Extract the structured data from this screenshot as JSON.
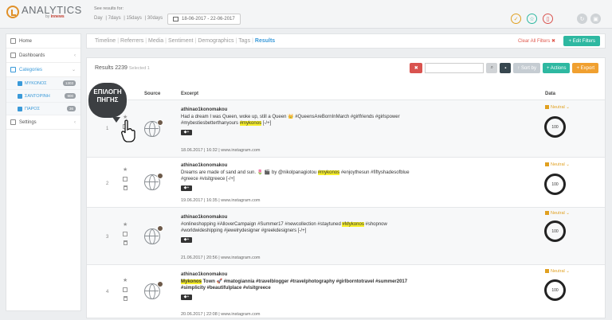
{
  "app": {
    "logo_text": "ANALYTICS",
    "logo_sub_prefix": "by ",
    "logo_sub_brand": "innews"
  },
  "header": {
    "results_for": "See results for:",
    "periods": [
      "Day",
      "7days",
      "15days",
      "30days"
    ],
    "date_range": "18-06-2017 - 22-06-2017",
    "icons": [
      "check-icon",
      "star-icon",
      "trash-icon",
      "refresh-icon",
      "cube-icon"
    ]
  },
  "sidebar": {
    "items": [
      {
        "label": "Home",
        "icon": "home-icon"
      },
      {
        "label": "Dashboards",
        "icon": "dashboard-icon"
      },
      {
        "label": "Categories",
        "icon": "tag-icon"
      },
      {
        "label": "Settings",
        "icon": "gear-icon"
      }
    ],
    "categories": [
      {
        "label": "ΜΥΚΟΝΟΣ",
        "count": "1303"
      },
      {
        "label": "ΣΑΝΤΟΡΙΝΗ",
        "count": "900"
      },
      {
        "label": "ΠΑΡΟΣ",
        "count": "36"
      }
    ]
  },
  "tabs": [
    "Timeline",
    "Referrers",
    "Media",
    "Sentiment",
    "Demographics",
    "Tags",
    "Results"
  ],
  "active_tab": "Results",
  "clear_filters": "Clear All Filters ✖",
  "edit_filters": "+ Edit Filters",
  "results": {
    "label": "Results 2239",
    "selected": "Selected 1"
  },
  "toolbar": {
    "sort": "↑ Sort by",
    "actions": "+ Actions",
    "export": "+ Export"
  },
  "columns": {
    "source": "Source",
    "excerpt": "Excerpt",
    "data": "Data"
  },
  "callout": {
    "line1": "ΕΠΙΛΟΓΗ",
    "line2": "ΠΗΓΗΣ"
  },
  "rows": [
    {
      "num": "1",
      "author": "athinao1konomakou",
      "pre": "Had a dream I was Queen, woke up, still a Queen 👑 #QueensAreBornInMarch #girlfriends #girlspower #mybestiesbetterthanyours ",
      "hl": "#mykonos",
      "post": " [-/+]",
      "meta": "18.06.2017 | 16:32 | www.instagram.com",
      "sentiment": "Neutral ⌄",
      "score": "100"
    },
    {
      "num": "2",
      "author": "athinao1konomakou",
      "pre": "Dreams are made of sand and sun. 🌷 🎬 by @nikolpanagiotou ",
      "hl": "#mykonos",
      "post": " #enjoythesun #fiftyshadesofblue #greece #visitgreece [-/+]",
      "meta": "19.06.2017 | 16:35 | www.instagram.com",
      "sentiment": "Neutral ⌄",
      "score": "100"
    },
    {
      "num": "3",
      "author": "athinao1konomakou",
      "pre": "#onlineshopping #AlloverCampaign #Summer17 #newcollection #staytuned ",
      "hl": "#Mykonos",
      "post": " #shopnow #worldwideshipping #jewelrydesigner #greekdesigners [-/+]",
      "meta": "21.06.2017 | 20:56 | www.instagram.com",
      "sentiment": "Neutral ⌄",
      "score": "100"
    },
    {
      "num": "4",
      "author": "athinao1konomakou",
      "pre": "",
      "hl": "Mykonos",
      "post": " Town 🚀 #matogiannia #travelblogger #travelphotography #girlborntotravel #summer2017 #simplicity #beautifulplace #visitgreece",
      "meta": "20.06.2017 | 22:08 | www.instagram.com",
      "sentiment": "Neutral ⌄",
      "score": "100"
    }
  ],
  "colors": {
    "accent": "#3a9ad9",
    "teal": "#2eb8a1",
    "orange": "#f0a030",
    "red": "#d9534f",
    "highlight": "#f7ef2a"
  }
}
